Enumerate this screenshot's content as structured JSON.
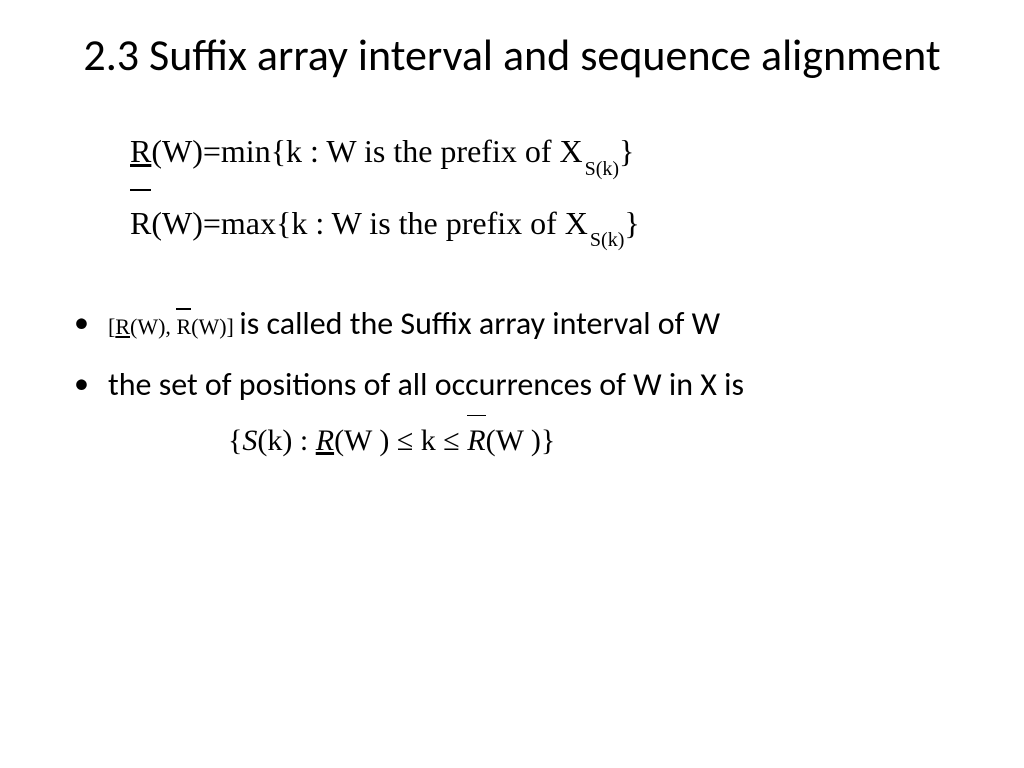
{
  "title": "2.3 Suffix array interval and sequence alignment",
  "equations": {
    "line1": {
      "R": "R",
      "W_paren": "(W)",
      "equals": " = ",
      "op": "min",
      "rest_a": "{k  : W is the prefix of  X",
      "sub": "S(k)",
      "rest_b": "}"
    },
    "line2": {
      "R": "R",
      "W_paren": "(W)",
      "equals": " = ",
      "op": "max",
      "rest_a": "{k : W is the prefix of  X",
      "sub": "S(k)",
      "rest_b": "}"
    }
  },
  "bullet1": {
    "interval_open": "[",
    "R_under": "R",
    "W1": "(W),",
    "space": " ",
    "R_over": "R",
    "W2": "(W)]",
    "rest": " is called the Suffix array interval of W"
  },
  "bullet2": {
    "text": "the set of positions of all occurrences of W in X is",
    "set_open": "{",
    "Sk": "S",
    "k_paren": "(k) : ",
    "R_under": "R",
    "W1": "(W ) ≤ k ≤ ",
    "R_over": "R",
    "W2": "(W )",
    "set_close": "}"
  }
}
